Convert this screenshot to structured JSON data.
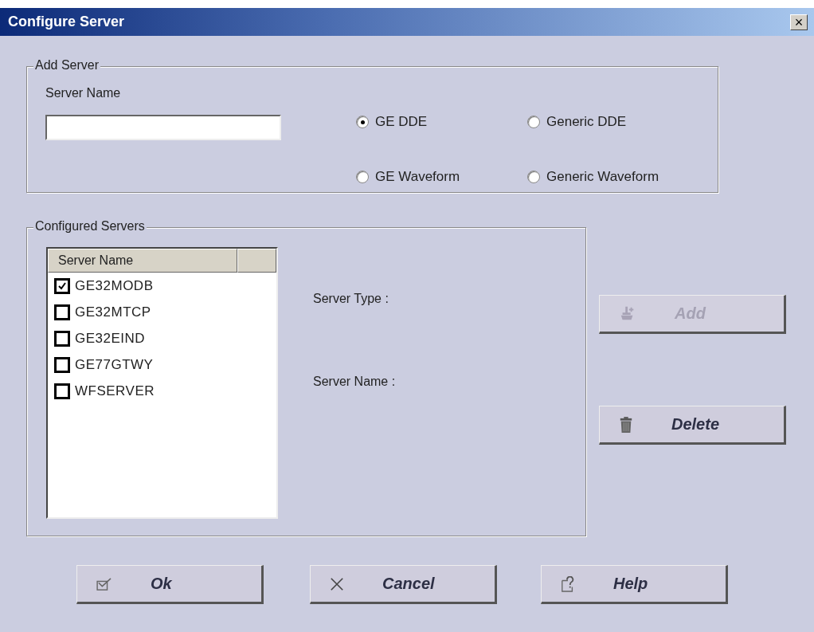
{
  "window": {
    "title": "Configure Server",
    "close": "×"
  },
  "add_server": {
    "legend": "Add Server",
    "name_label": "Server Name",
    "types": [
      {
        "label": "GE DDE",
        "selected": true
      },
      {
        "label": "Generic DDE",
        "selected": false
      },
      {
        "label": "GE Waveform",
        "selected": false
      },
      {
        "label": "Generic Waveform",
        "selected": false
      }
    ]
  },
  "configured": {
    "legend": "Configured Servers",
    "columns": [
      "Server Name"
    ],
    "servers": [
      {
        "name": "GE32MODB",
        "checked": true
      },
      {
        "name": "GE32MTCP",
        "checked": false
      },
      {
        "name": "GE32EIND",
        "checked": false
      },
      {
        "name": "GE77GTWY",
        "checked": false
      },
      {
        "name": "WFSERVER",
        "checked": false
      }
    ],
    "type_label": "Server Type :",
    "server_name_label": "Server Name :"
  },
  "side_buttons": [
    {
      "kind": "add",
      "label": "Add",
      "disabled": true
    },
    {
      "kind": "delete",
      "label": "Delete",
      "disabled": false
    }
  ],
  "buttons": [
    {
      "kind": "ok",
      "label": "Ok"
    },
    {
      "kind": "cancel",
      "label": "Cancel"
    },
    {
      "kind": "help",
      "label": "Help"
    }
  ]
}
